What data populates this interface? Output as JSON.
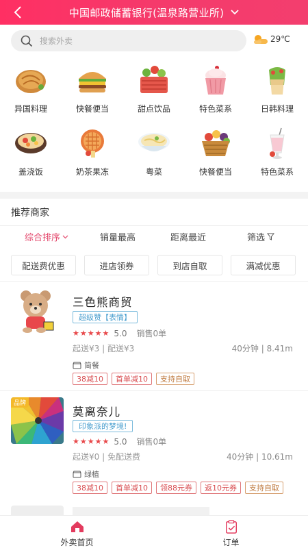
{
  "header": {
    "title": "中国邮政储蓄银行(温泉路营业所)"
  },
  "search": {
    "placeholder": "搜索外卖"
  },
  "weather": {
    "temp": "29℃",
    "icon": "sun-cloud-icon"
  },
  "categories": [
    {
      "label": "异国料理",
      "icon": "pizza-icon"
    },
    {
      "label": "快餐便当",
      "icon": "burger-icon"
    },
    {
      "label": "甜点饮品",
      "icon": "basket-icon"
    },
    {
      "label": "特色菜系",
      "icon": "cupcake-icon"
    },
    {
      "label": "日韩料理",
      "icon": "wrap-icon"
    },
    {
      "label": "盖浇饭",
      "icon": "claypot-icon"
    },
    {
      "label": "奶茶果冻",
      "icon": "waffle-icon"
    },
    {
      "label": "粤菜",
      "icon": "noodle-bowl-icon"
    },
    {
      "label": "快餐便当",
      "icon": "fruit-basket-icon"
    },
    {
      "label": "特色菜系",
      "icon": "milkshake-icon"
    }
  ],
  "recommend": {
    "title": "推荐商家"
  },
  "sort_tabs": [
    "综合排序",
    "销量最高",
    "距离最近",
    "筛选"
  ],
  "filters": [
    "配送费优惠",
    "进店领券",
    "到店自取",
    "满减优惠"
  ],
  "shops": [
    {
      "name": "三色熊商贸",
      "tag": "超级赞【表情】",
      "rating": "5.0",
      "sales": "销售0单",
      "delivery": "起送¥3 | 配送¥3",
      "time": "40分钟 | 8.41m",
      "category": "简餐",
      "promos": [
        "38减10",
        "首单减10",
        "支持自取"
      ]
    },
    {
      "name": "莫离奈儿",
      "badge": "品牌",
      "tag": "印象派的梦境!",
      "rating": "5.0",
      "sales": "销售0单",
      "delivery": "起送¥0 | 免配送费",
      "time": "40分钟 | 10.61m",
      "category": "绿植",
      "promos": [
        "38减10",
        "首单减10",
        "领88元券",
        "返10元券",
        "支持自取"
      ]
    }
  ],
  "bottom_nav": [
    {
      "label": "外卖首页",
      "icon": "home-icon"
    },
    {
      "label": "订单",
      "icon": "order-icon"
    }
  ],
  "colors": {
    "accent": "#f33e6e",
    "star": "#e8484a"
  }
}
